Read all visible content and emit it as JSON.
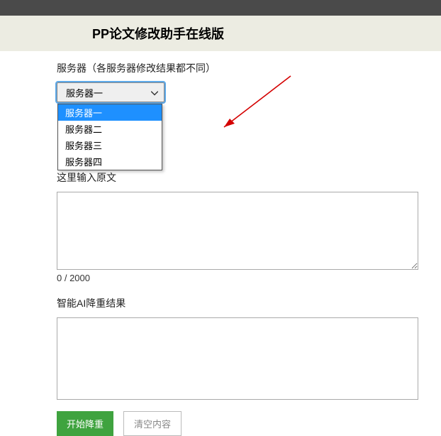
{
  "header": {
    "title": "PP论文修改助手在线版"
  },
  "server": {
    "label": "服务器（各服务器修改结果都不同）",
    "selected": "服务器一",
    "options": [
      "服务器一",
      "服务器二",
      "服务器三",
      "服务器四"
    ]
  },
  "input": {
    "label": "这里输入原文",
    "value": "",
    "counter": "0 / 2000"
  },
  "output": {
    "label": "智能AI降重结果",
    "value": ""
  },
  "buttons": {
    "start": "开始降重",
    "clear": "清空内容"
  },
  "annotation": {
    "arrow_color": "#d40000"
  }
}
